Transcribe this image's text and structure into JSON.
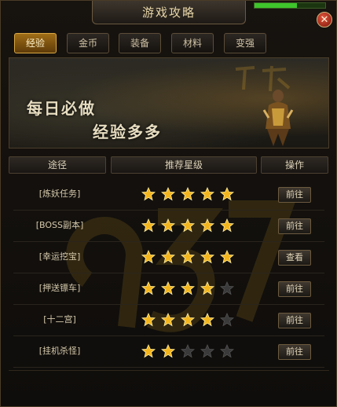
{
  "window": {
    "title": "游戏攻略"
  },
  "tabs": [
    {
      "label": "经验",
      "active": true
    },
    {
      "label": "金币",
      "active": false
    },
    {
      "label": "装备",
      "active": false
    },
    {
      "label": "材料",
      "active": false
    },
    {
      "label": "变强",
      "active": false
    }
  ],
  "banner": {
    "line1": "每日必做",
    "line2": "经验多多"
  },
  "columns": {
    "route": "途径",
    "rating": "推荐星级",
    "action": "操作"
  },
  "rows": [
    {
      "name": "[炼妖任务]",
      "stars": 5,
      "button": "前往"
    },
    {
      "name": "[BOSS副本]",
      "stars": 5,
      "button": "前往"
    },
    {
      "name": "[幸运挖宝]",
      "stars": 5,
      "button": "查看"
    },
    {
      "name": "[押送镖车]",
      "stars": 4,
      "button": "前往"
    },
    {
      "name": "[十二宫]",
      "stars": 4,
      "button": "前往"
    },
    {
      "name": "[挂机杀怪]",
      "stars": 2,
      "button": "前往"
    }
  ],
  "colors": {
    "star_on": "#f3b51e",
    "star_off": "#3a3a3a",
    "accent": "#c08a2a"
  },
  "icons": {
    "close": "close-icon",
    "star": "star-icon"
  }
}
